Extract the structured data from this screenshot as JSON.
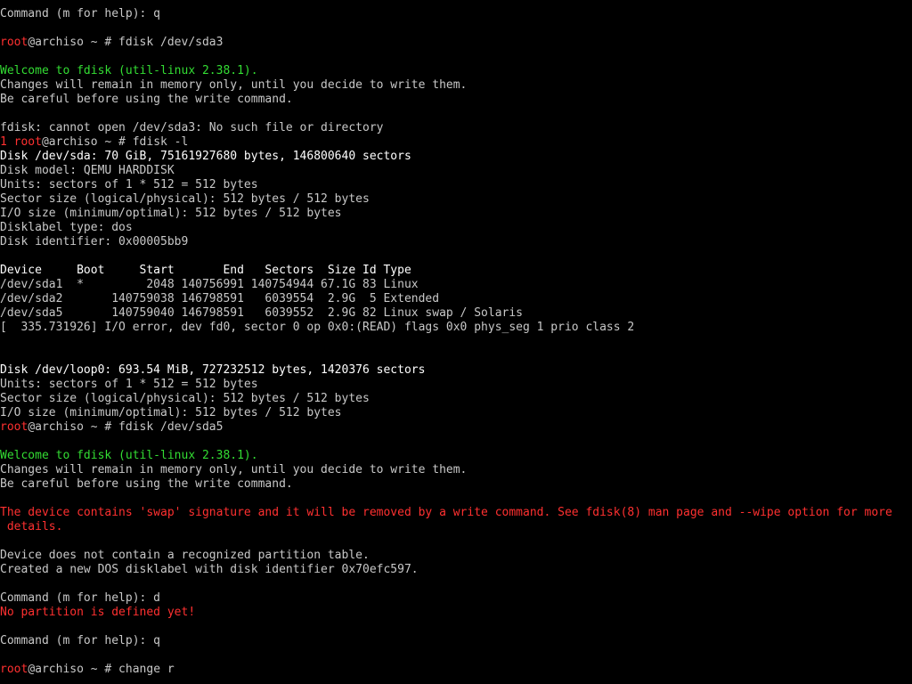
{
  "screen": {
    "background": "#000000",
    "colors": {
      "default": "#c8c8c8",
      "bold": "#ffffff",
      "red": "#ff3030",
      "green": "#33dd33"
    }
  },
  "lines": [
    {
      "kind": "command-prompt",
      "segments": [
        {
          "text": "Command (m for help): q",
          "color": "default"
        }
      ]
    },
    {
      "kind": "blank",
      "segments": []
    },
    {
      "kind": "shell-prompt",
      "segments": [
        {
          "text": "root",
          "color": "red"
        },
        {
          "text": "@archiso ~ # fdisk /dev/sda3",
          "color": "default"
        }
      ]
    },
    {
      "kind": "blank",
      "segments": []
    },
    {
      "kind": "output",
      "segments": [
        {
          "text": "Welcome to fdisk (util-linux 2.38.1).",
          "color": "green"
        }
      ]
    },
    {
      "kind": "output",
      "segments": [
        {
          "text": "Changes will remain in memory only, until you decide to write them.",
          "color": "default"
        }
      ]
    },
    {
      "kind": "output",
      "segments": [
        {
          "text": "Be careful before using the write command.",
          "color": "default"
        }
      ]
    },
    {
      "kind": "blank",
      "segments": []
    },
    {
      "kind": "output",
      "segments": [
        {
          "text": "fdisk: cannot open /dev/sda3: No such file or directory",
          "color": "default"
        }
      ]
    },
    {
      "kind": "shell-prompt",
      "segments": [
        {
          "text": "1 root",
          "color": "red"
        },
        {
          "text": "@archiso ~ # fdisk -l",
          "color": "default"
        }
      ]
    },
    {
      "kind": "output",
      "segments": [
        {
          "text": "Disk /dev/sda: 70 GiB, 75161927680 bytes, 146800640 sectors",
          "color": "bold"
        }
      ]
    },
    {
      "kind": "output",
      "segments": [
        {
          "text": "Disk model: QEMU HARDDISK",
          "color": "default"
        }
      ]
    },
    {
      "kind": "output",
      "segments": [
        {
          "text": "Units: sectors of 1 * 512 = 512 bytes",
          "color": "default"
        }
      ]
    },
    {
      "kind": "output",
      "segments": [
        {
          "text": "Sector size (logical/physical): 512 bytes / 512 bytes",
          "color": "default"
        }
      ]
    },
    {
      "kind": "output",
      "segments": [
        {
          "text": "I/O size (minimum/optimal): 512 bytes / 512 bytes",
          "color": "default"
        }
      ]
    },
    {
      "kind": "output",
      "segments": [
        {
          "text": "Disklabel type: dos",
          "color": "default"
        }
      ]
    },
    {
      "kind": "output",
      "segments": [
        {
          "text": "Disk identifier: 0x00005bb9",
          "color": "default"
        }
      ]
    },
    {
      "kind": "blank",
      "segments": []
    },
    {
      "kind": "table-header",
      "segments": [
        {
          "text": "Device     Boot     Start       End   Sectors  Size Id Type",
          "color": "bold"
        }
      ]
    },
    {
      "kind": "table-row",
      "segments": [
        {
          "text": "/dev/sda1  *         2048 140756991 140754944 67.1G 83 Linux",
          "color": "default"
        }
      ]
    },
    {
      "kind": "table-row",
      "segments": [
        {
          "text": "/dev/sda2       140759038 146798591   6039554  2.9G  5 Extended",
          "color": "default"
        }
      ]
    },
    {
      "kind": "table-row",
      "segments": [
        {
          "text": "/dev/sda5       140759040 146798591   6039552  2.9G 82 Linux swap / Solaris",
          "color": "default"
        }
      ]
    },
    {
      "kind": "kernel-message",
      "segments": [
        {
          "text": "[  335.731926] I/O error, dev fd0, sector 0 op 0x0:(READ) flags 0x0 phys_seg 1 prio class 2",
          "color": "default"
        }
      ]
    },
    {
      "kind": "blank",
      "segments": []
    },
    {
      "kind": "blank",
      "segments": []
    },
    {
      "kind": "output",
      "segments": [
        {
          "text": "Disk /dev/loop0: 693.54 MiB, 727232512 bytes, 1420376 sectors",
          "color": "bold"
        }
      ]
    },
    {
      "kind": "output",
      "segments": [
        {
          "text": "Units: sectors of 1 * 512 = 512 bytes",
          "color": "default"
        }
      ]
    },
    {
      "kind": "output",
      "segments": [
        {
          "text": "Sector size (logical/physical): 512 bytes / 512 bytes",
          "color": "default"
        }
      ]
    },
    {
      "kind": "output",
      "segments": [
        {
          "text": "I/O size (minimum/optimal): 512 bytes / 512 bytes",
          "color": "default"
        }
      ]
    },
    {
      "kind": "shell-prompt",
      "segments": [
        {
          "text": "root",
          "color": "red"
        },
        {
          "text": "@archiso ~ # fdisk /dev/sda5",
          "color": "default"
        }
      ]
    },
    {
      "kind": "blank",
      "segments": []
    },
    {
      "kind": "output",
      "segments": [
        {
          "text": "Welcome to fdisk (util-linux 2.38.1).",
          "color": "green"
        }
      ]
    },
    {
      "kind": "output",
      "segments": [
        {
          "text": "Changes will remain in memory only, until you decide to write them.",
          "color": "default"
        }
      ]
    },
    {
      "kind": "output",
      "segments": [
        {
          "text": "Be careful before using the write command.",
          "color": "default"
        }
      ]
    },
    {
      "kind": "blank",
      "segments": []
    },
    {
      "kind": "warning",
      "segments": [
        {
          "text": "The device contains 'swap' signature and it will be removed by a write command. See fdisk(8) man page and --wipe option for more",
          "color": "red"
        }
      ]
    },
    {
      "kind": "warning",
      "segments": [
        {
          "text": " details.",
          "color": "red"
        }
      ]
    },
    {
      "kind": "blank",
      "segments": []
    },
    {
      "kind": "output",
      "segments": [
        {
          "text": "Device does not contain a recognized partition table.",
          "color": "default"
        }
      ]
    },
    {
      "kind": "output",
      "segments": [
        {
          "text": "Created a new DOS disklabel with disk identifier 0x70efc597.",
          "color": "default"
        }
      ]
    },
    {
      "kind": "blank",
      "segments": []
    },
    {
      "kind": "command-prompt",
      "segments": [
        {
          "text": "Command (m for help): d",
          "color": "default"
        }
      ]
    },
    {
      "kind": "warning",
      "segments": [
        {
          "text": "No partition is defined yet!",
          "color": "red"
        }
      ]
    },
    {
      "kind": "blank",
      "segments": []
    },
    {
      "kind": "command-prompt",
      "segments": [
        {
          "text": "Command (m for help): q",
          "color": "default"
        }
      ]
    },
    {
      "kind": "blank",
      "segments": []
    },
    {
      "kind": "shell-prompt",
      "segments": [
        {
          "text": "root",
          "color": "red"
        },
        {
          "text": "@archiso ~ # change r",
          "color": "default"
        }
      ]
    }
  ]
}
